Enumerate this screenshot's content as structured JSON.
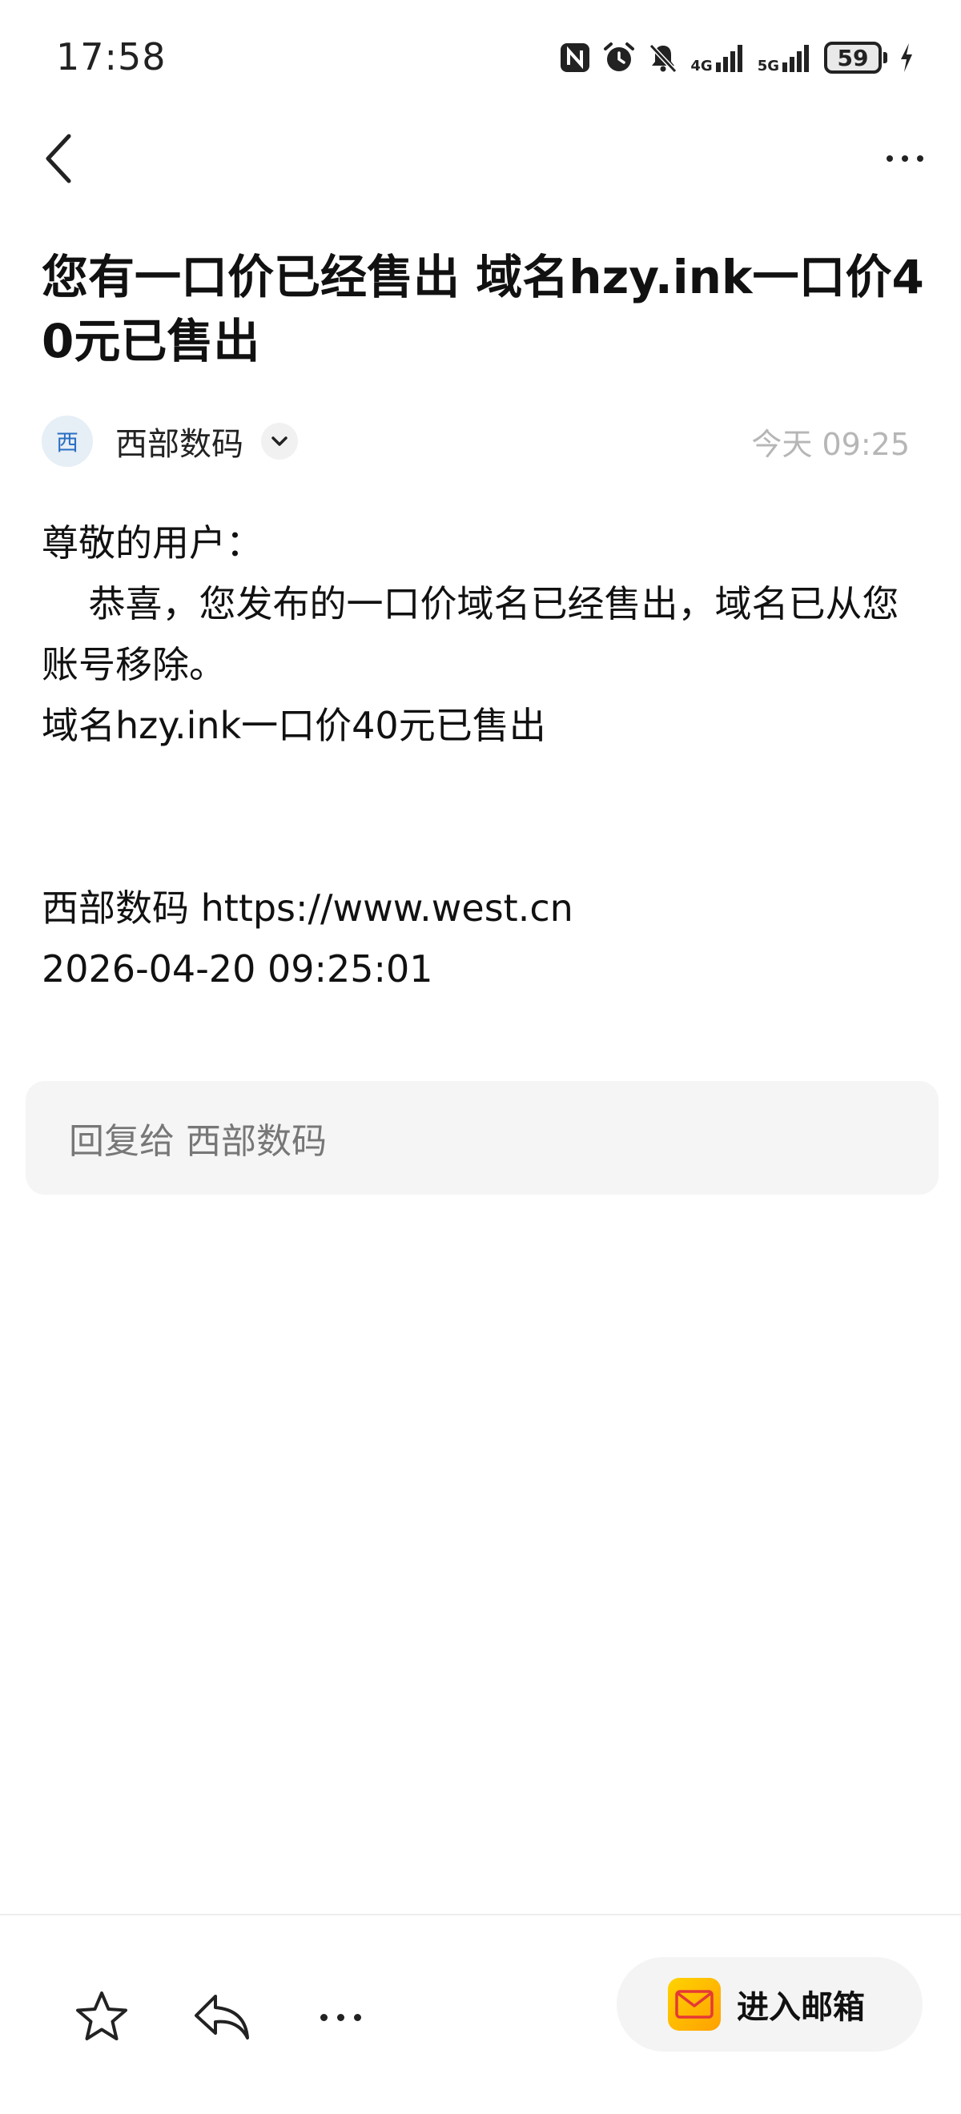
{
  "status_bar": {
    "time": "17:58",
    "icons": [
      "nfc-icon",
      "alarm-icon",
      "mute-icon",
      "signal-4g-icon",
      "signal-5g-icon",
      "battery-icon",
      "charging-icon"
    ],
    "network_4g": "4G",
    "network_5g": "5G",
    "battery": "59"
  },
  "nav": {
    "back_icon": "chevron-left-icon",
    "more_icon": "more-icon"
  },
  "email": {
    "subject": "您有一口价已经售出 域名hzy.ink一口价40元已售出",
    "sender": {
      "avatar_char": "西",
      "name": "西部数码",
      "time": "今天 09:25",
      "avatar_color": "#2a6fc2"
    },
    "body": {
      "greeting": "尊敬的用户：",
      "paragraph": "    恭喜，您发布的一口价域名已经售出，域名已从您账号移除。",
      "detail": "域名hzy.ink一口价40元已售出",
      "signature": "西部数码 https://www.west.cn",
      "datetime": "2026-04-20 09:25:01"
    }
  },
  "reply": {
    "placeholder": "回复给 西部数码"
  },
  "bottom_bar": {
    "star_icon": "star-icon",
    "reply_icon": "reply-icon",
    "more_icon": "more-icon",
    "enter_mailbox_label": "进入邮箱",
    "mail_icon": "mail-icon",
    "accent": "#ffb800"
  }
}
